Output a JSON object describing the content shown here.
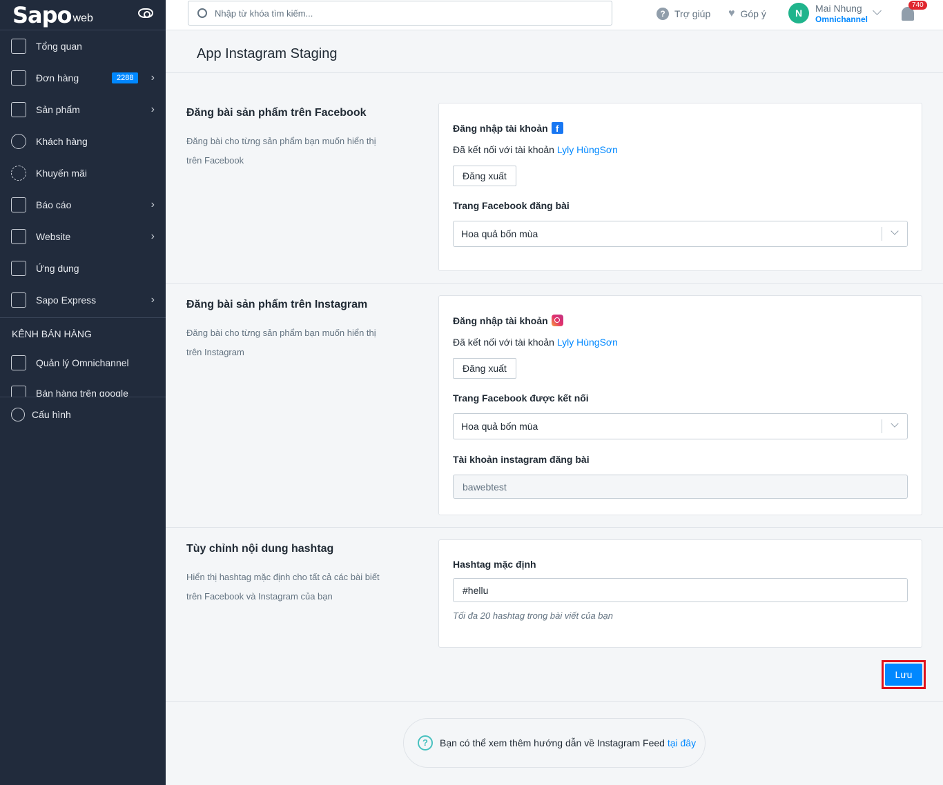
{
  "sidebar": {
    "logo": "Sapo",
    "logo_sub": "web",
    "items": [
      {
        "label": "Tổng quan"
      },
      {
        "label": "Đơn hàng",
        "badge": "2288"
      },
      {
        "label": "Sản phẩm"
      },
      {
        "label": "Khách hàng"
      },
      {
        "label": "Khuyến mãi"
      },
      {
        "label": "Báo cáo"
      },
      {
        "label": "Website"
      },
      {
        "label": "Ứng dụng"
      },
      {
        "label": "Sapo Express"
      }
    ],
    "channel_title": "KÊNH BÁN HÀNG",
    "channel_items": [
      {
        "label": "Quản lý Omnichannel"
      },
      {
        "label": "Bán hàng trên google"
      }
    ],
    "settings": "Cấu hình"
  },
  "topbar": {
    "search_placeholder": "Nhập từ khóa tìm kiếm...",
    "help": "Trợ giúp",
    "feedback": "Góp ý",
    "avatar_initial": "N",
    "user_name": "Mai Nhung",
    "user_org": "Omnichannel",
    "notifications": "740"
  },
  "page": {
    "title": "App Instagram Staging"
  },
  "facebook": {
    "title": "Đăng bài sản phẩm trên Facebook",
    "desc": "Đăng bài cho từng sản phẩm bạn muốn hiển thị trên Facebook",
    "login_label": "Đăng nhập tài khoản",
    "connected_text": "Đã kết nối với tài khoản",
    "account": "Lyly HùngSơn",
    "logout": "Đăng xuất",
    "page_label": "Trang Facebook đăng bài",
    "page_value": "Hoa quả bốn mùa"
  },
  "instagram": {
    "title": "Đăng bài sản phẩm trên Instagram",
    "desc": "Đăng bài cho từng sản phẩm bạn muốn hiển thị trên Instagram",
    "login_label": "Đăng nhập tài khoản",
    "connected_text": "Đã kết nối với tài khoản",
    "account": "Lyly HùngSơn",
    "logout": "Đăng xuất",
    "page_label": "Trang Facebook được kết nối",
    "page_value": "Hoa quả bốn mùa",
    "ig_label": "Tài khoản instagram đăng bài",
    "ig_value": "bawebtest"
  },
  "hashtag": {
    "title": "Tùy chỉnh nội dung hashtag",
    "desc": "Hiển thị hashtag mặc định cho tất cả các bài biết trên Facebook và Instagram của bạn",
    "label": "Hashtag mặc định",
    "value": "#hellu",
    "hint": "Tối đa 20 hashtag trong bài viết của bạn"
  },
  "save_label": "Lưu",
  "help": {
    "text": "Bạn có thể xem thêm hướng dẫn về Instagram Feed",
    "link": "tại đây"
  }
}
